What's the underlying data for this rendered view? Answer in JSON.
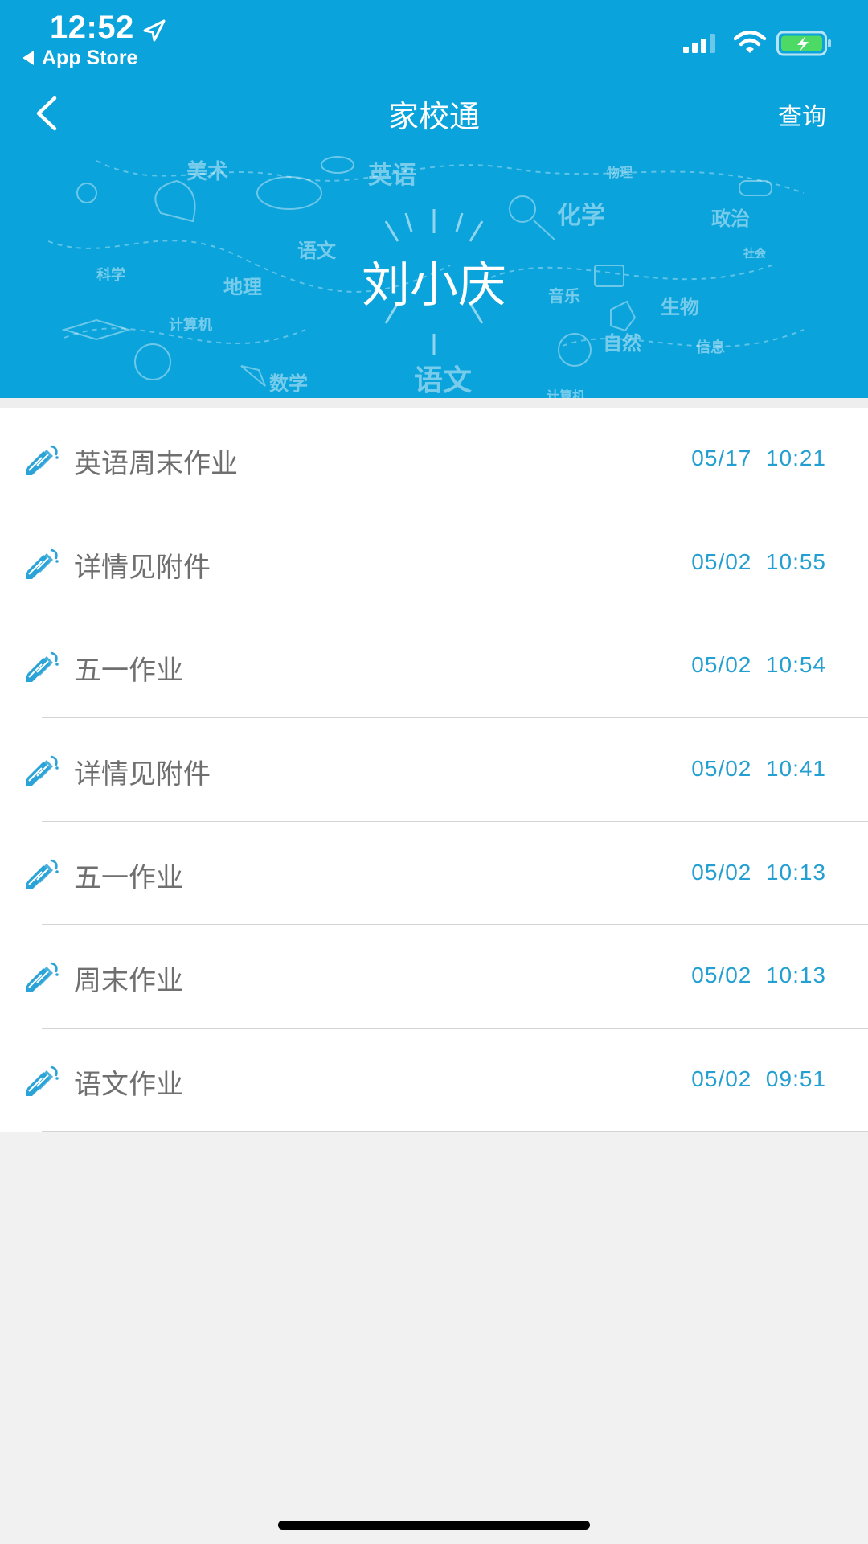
{
  "status_bar": {
    "time": "12:52",
    "back_app": "App Store"
  },
  "nav": {
    "title": "家校通",
    "action": "查询"
  },
  "banner": {
    "student_name": "刘小庆",
    "doodles": [
      "美术",
      "英语",
      "物理",
      "化学",
      "政治",
      "社会",
      "科学",
      "语文",
      "地理",
      "计算机",
      "音乐",
      "生物",
      "自然",
      "信息",
      "数学",
      "语文",
      "计算机"
    ]
  },
  "homework_list": [
    {
      "title": "英语周末作业",
      "time": "05/17  10:21"
    },
    {
      "title": "详情见附件",
      "time": "05/02  10:55"
    },
    {
      "title": "五一作业",
      "time": "05/02  10:54"
    },
    {
      "title": "详情见附件",
      "time": "05/02  10:41"
    },
    {
      "title": "五一作业",
      "time": "05/02  10:13"
    },
    {
      "title": "周末作业",
      "time": "05/02  10:13"
    },
    {
      "title": "语文作业",
      "time": "05/02  09:51"
    }
  ],
  "colors": {
    "banner": "#0aa3db",
    "time_text": "#239fd1",
    "title_text": "#6f6f6f",
    "background": "#f1f1f1"
  },
  "icons": {
    "row": "pen-icon",
    "nav_back": "chevron-left-icon"
  }
}
